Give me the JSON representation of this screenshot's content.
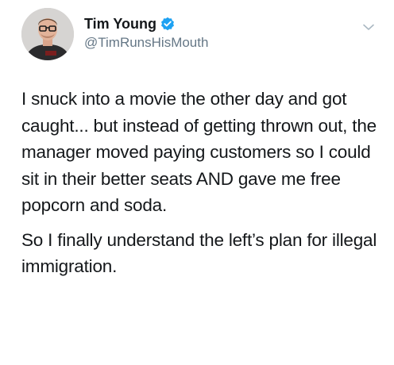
{
  "tweet": {
    "author": {
      "display_name": "Tim Young",
      "handle": "@TimRunsHisMouth",
      "verified": true
    },
    "icons": {
      "avatar": "avatar-photo",
      "verified": "verified-badge-icon",
      "menu": "chevron-down-icon"
    },
    "colors": {
      "text": "#14171a",
      "handle": "#657786",
      "verified_badge": "#1da1f2",
      "chevron": "#aab8c2"
    },
    "body": {
      "paragraph_1": "I snuck into a movie the other day and got caught... but instead of getting thrown out, the manager moved paying customers so I could sit in their better seats AND gave me free popcorn and soda.",
      "paragraph_2": "So I finally understand the left’s plan for illegal immigration."
    }
  }
}
